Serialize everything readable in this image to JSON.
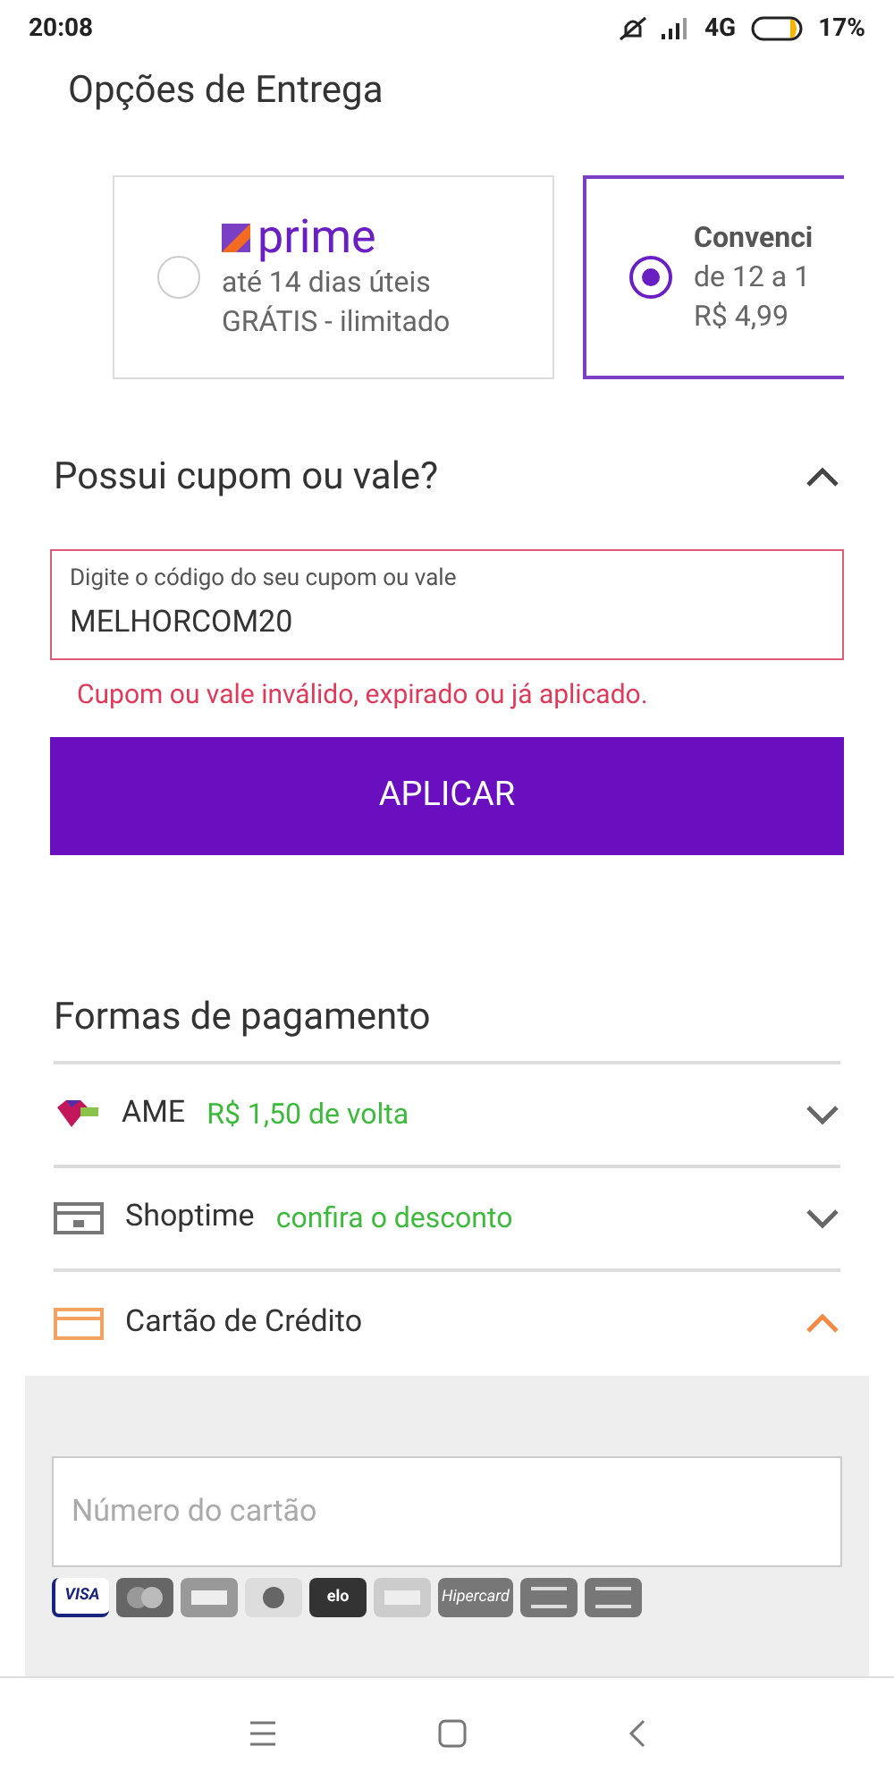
{
  "status_bar": {
    "time": "20:08",
    "network": "4G",
    "battery": "17%"
  },
  "delivery": {
    "title": "Opções de Entrega",
    "options": [
      {
        "kind": "prime",
        "brand": "prime",
        "lines": [
          "até 14 dias úteis",
          "GRÁTIS - ilimitado"
        ],
        "selected": false
      },
      {
        "kind": "plain",
        "name": "Convenci",
        "lines": [
          "de 12 a 1",
          "R$ 4,99"
        ],
        "selected": true
      }
    ]
  },
  "coupon": {
    "title": "Possui cupom ou vale?",
    "expanded": true,
    "field_label": "Digite o código do seu cupom ou vale",
    "value": "MELHORCOM20",
    "error": "Cupom ou vale inválido, expirado ou já aplicado.",
    "button": "APLICAR"
  },
  "payment": {
    "title": "Formas de pagamento",
    "methods": [
      {
        "kind": "ame",
        "name": "AME",
        "note": "R$ 1,50 de volta",
        "expanded": false
      },
      {
        "kind": "voucher",
        "name": "Shoptime",
        "note": "confira o desconto",
        "expanded": false
      },
      {
        "kind": "card",
        "name": "Cartão de Crédito",
        "expanded": true
      }
    ],
    "card_number_placeholder": "Número do cartão",
    "brands": [
      {
        "kind": "visa",
        "label": "VISA"
      },
      {
        "kind": "master"
      },
      {
        "kind": "amex"
      },
      {
        "kind": "diners"
      },
      {
        "kind": "elo",
        "label": "elo"
      },
      {
        "kind": "aura"
      },
      {
        "kind": "hiper",
        "label": "Hipercard"
      },
      {
        "kind": "generic"
      },
      {
        "kind": "generic"
      }
    ]
  }
}
